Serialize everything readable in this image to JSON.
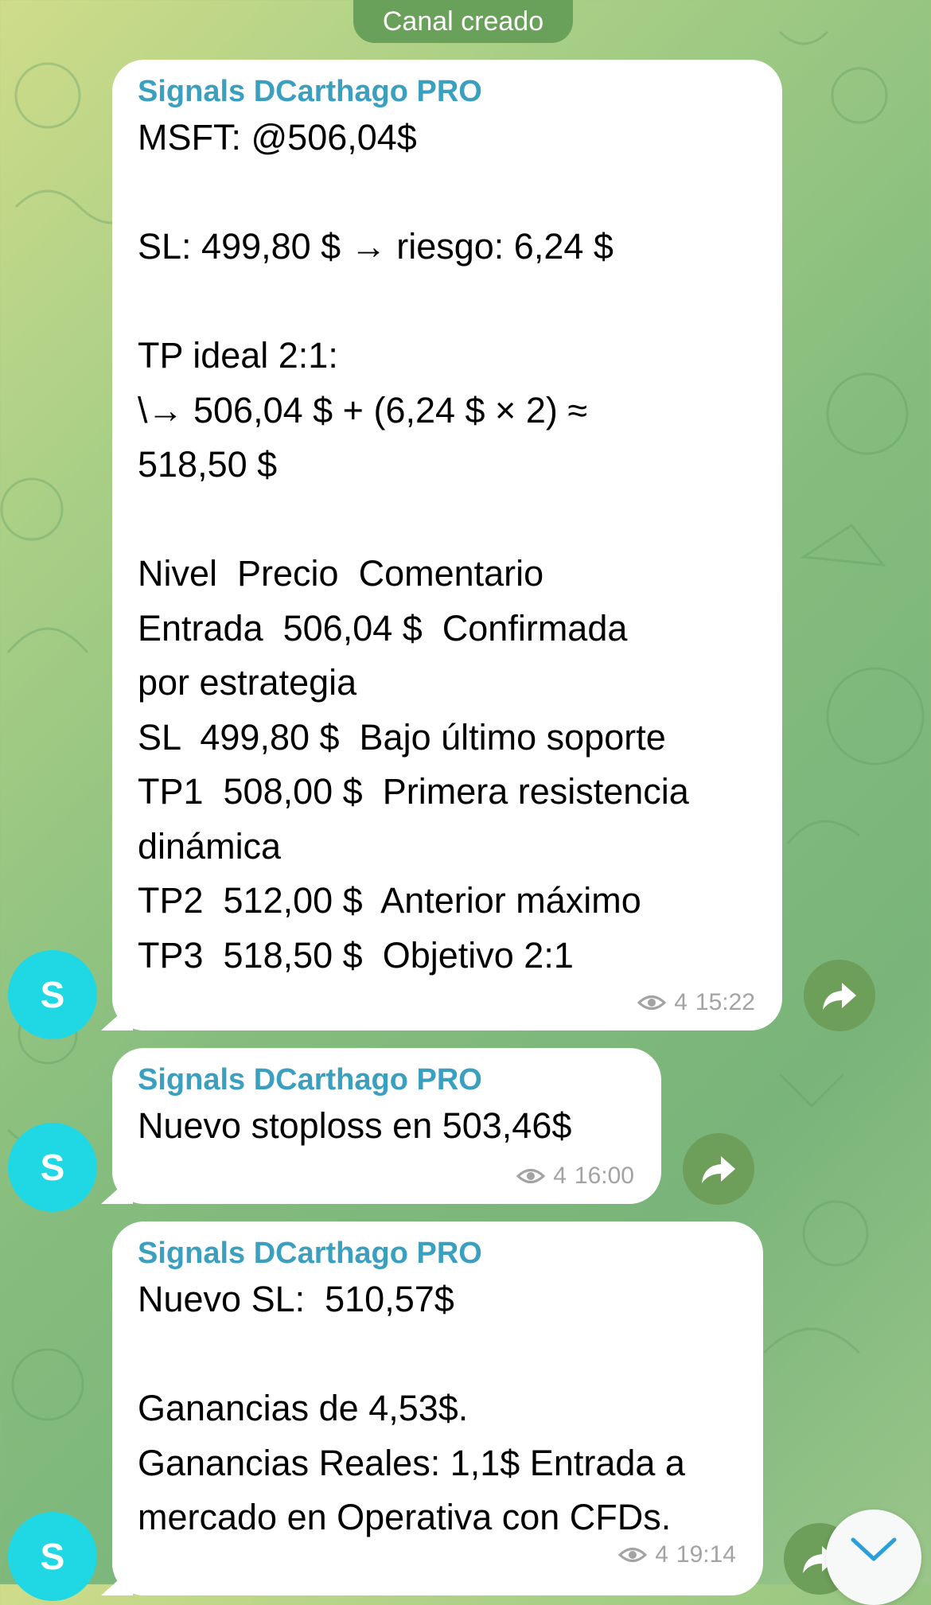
{
  "service_message": "Canal creado",
  "channel": {
    "avatar_letter": "S"
  },
  "messages": [
    {
      "sender": "Signals DCarthago PRO",
      "text": "MSFT: @506,04$\n\nSL: 499,80 $ → riesgo: 6,24 $\n\nTP ideal 2:1:\n\\→ 506,04 $ + (6,24 $ × 2) ≈\n518,50 $\n\nNivel  Precio  Comentario\nEntrada  506,04 $  Confirmada\npor estrategia\nSL  499,80 $  Bajo último soporte\nTP1  508,00 $  Primera resistencia\ndinámica\nTP2  512,00 $  Anterior máximo\nTP3  518,50 $  Objetivo 2:1",
      "views": "4",
      "time": "15:22"
    },
    {
      "sender": "Signals DCarthago PRO",
      "text": "Nuevo stoploss en 503,46$",
      "views": "4",
      "time": "16:00"
    },
    {
      "sender": "Signals DCarthago PRO",
      "text": "Nuevo SL:  510,57$\n\nGanancias de 4,53$.\nGanancias Reales: 1,1$ Entrada a\nmercado en Operativa con CFDs.",
      "views": "4",
      "time": "19:14"
    }
  ],
  "icons": {
    "views": "eye-icon",
    "share": "share-arrow-icon",
    "scroll": "chevron-down-icon"
  },
  "colors": {
    "sender": "#3ba0c0",
    "avatar": "#1fd8e4",
    "share_button": "#6d9e5a",
    "service_pill": "#6aa15a"
  }
}
